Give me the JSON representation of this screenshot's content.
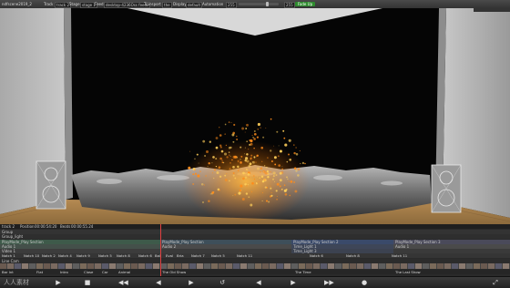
{
  "toolbar": {
    "file_name": "ndfscene2019_2",
    "track_label": "Track",
    "track_value": "track 2",
    "stage_label": "Stage",
    "stage_value": "stage 1",
    "feed_label": "Feed",
    "feed_value": "desktop-4236Oss feeds",
    "transport_label": "Transport",
    "transport_value": "the",
    "display_label": "Display",
    "display_value": "default",
    "automation_label": "Automation",
    "level_1": "255",
    "level_2": "255",
    "fade_up_label": "Fade Up"
  },
  "timeline": {
    "track_name": "track 2",
    "position_label": "Position",
    "position_value": "00:00:54:20",
    "beats_label": "Beats",
    "beats_value": "00:00:55.24",
    "rows": [
      {
        "label": "Group"
      },
      {
        "label": "Group_light"
      }
    ],
    "section_rows": [
      {
        "segments": [
          "PlayMode_Play Section",
          "PlayMode_Play Section",
          "PlayMode_Play Section 2",
          "PlayMode_Play Section 3"
        ]
      },
      {
        "segments": [
          "Audio 1",
          "Audio 2",
          "Time_Light 1",
          "Audio 1"
        ]
      },
      {
        "segments": [
          "Video 1",
          "",
          "Time_Light 3",
          ""
        ]
      }
    ],
    "notch_row": [
      "Notch 1",
      "Notch 10",
      "Notch 2",
      "Notch 4",
      "Notch 9",
      "Notch 5",
      "Notch 8",
      "Notch 6",
      "Ball",
      "Eval",
      "Bria",
      "Notch 7",
      "Notch 5",
      "Notch 11",
      "Notch 6",
      "Notch 8",
      "Notch 11"
    ],
    "line_cam_label": "Line Cam",
    "cues": [
      "Bar Int",
      "Flat",
      "Intro",
      "Close",
      "Car",
      "Animal",
      "The Old Show",
      "The Time",
      "The Last Show"
    ]
  },
  "controls": {
    "watermark": "人人素材"
  },
  "icons": {
    "play": "play-icon",
    "stop": "stop-icon",
    "rewind": "rewind-icon",
    "loop": "loop-icon",
    "forward": "forward-icon",
    "record": "record-icon"
  },
  "colors": {
    "accent_green": "#2e8b2e",
    "particle_orange": "#ff9a1a",
    "row_green": "#3e5a4a",
    "row_blue": "#3a4a6a",
    "row_grey": "#4a4a4a"
  }
}
